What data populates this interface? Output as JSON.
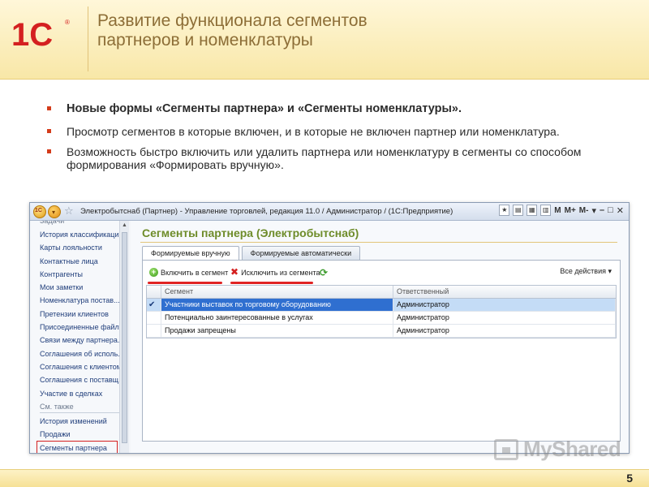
{
  "slide": {
    "title_line1": "Развитие функционала сегментов",
    "title_line2": "партнеров и номенклатуры",
    "bullets": [
      "Новые формы «Сегменты партнера» и «Сегменты номенклатуры».",
      "Просмотр сегментов в которые включен, и в которые не включен партнер или номенклатура.",
      "Возможность быстро включить или удалить партнера  или номенклатуру в сегменты со способом формирования «Формировать вручную»."
    ],
    "page_number": "5",
    "logo_text": "1С",
    "watermark": "MyShared"
  },
  "window": {
    "title": "Электробытснаб (Партнер) - Управление торговлей, редакция 11.0 / Администратор /  (1С:Предприятие)",
    "toolbar_right": [
      "M",
      "M+",
      "M-"
    ],
    "btn1_label": "1С",
    "btn2_label": "▾"
  },
  "sidebar": {
    "cut_item": "Задачи",
    "items": [
      "История классификации",
      "Карты лояльности",
      "Контактные лица",
      "Контрагенты",
      "Мои заметки",
      "Номенклатура постав...",
      "Претензии клиентов",
      "Присоединенные файлы",
      "Связи между партнера...",
      "Соглашения об исполь...",
      "Соглашения с клиентом",
      "Соглашения с поставщ...",
      "Участие в сделках"
    ],
    "see_also_label": "См. также",
    "see_also_items": [
      "История изменений",
      "Продажи",
      "Сегменты партнера"
    ]
  },
  "form": {
    "title": "Сегменты партнера (Электробытснаб)",
    "tabs": [
      "Формируемые вручную",
      "Формируемые автоматически"
    ],
    "include_label": "Включить в сегмент",
    "exclude_label": "Исключить из сегмента",
    "all_actions_label": "Все действия ▾",
    "table": {
      "headers": [
        "Сегмент",
        "Ответственный"
      ],
      "rows": [
        {
          "checked": "✔",
          "segment": "Участники выставок по торговому оборудованию",
          "responsible": "Администратор"
        },
        {
          "checked": "",
          "segment": "Потенциально заинтересованные в услугах",
          "responsible": "Администратор"
        },
        {
          "checked": "",
          "segment": "Продажи запрещены",
          "responsible": "Администратор"
        }
      ]
    }
  },
  "colors": {
    "title_text": "#8d6e37",
    "bullet_marker": "#d43c1b",
    "form_title": "#6e8c2a",
    "highlight_red": "#e02424",
    "selected_row": "#2f6fd0"
  }
}
